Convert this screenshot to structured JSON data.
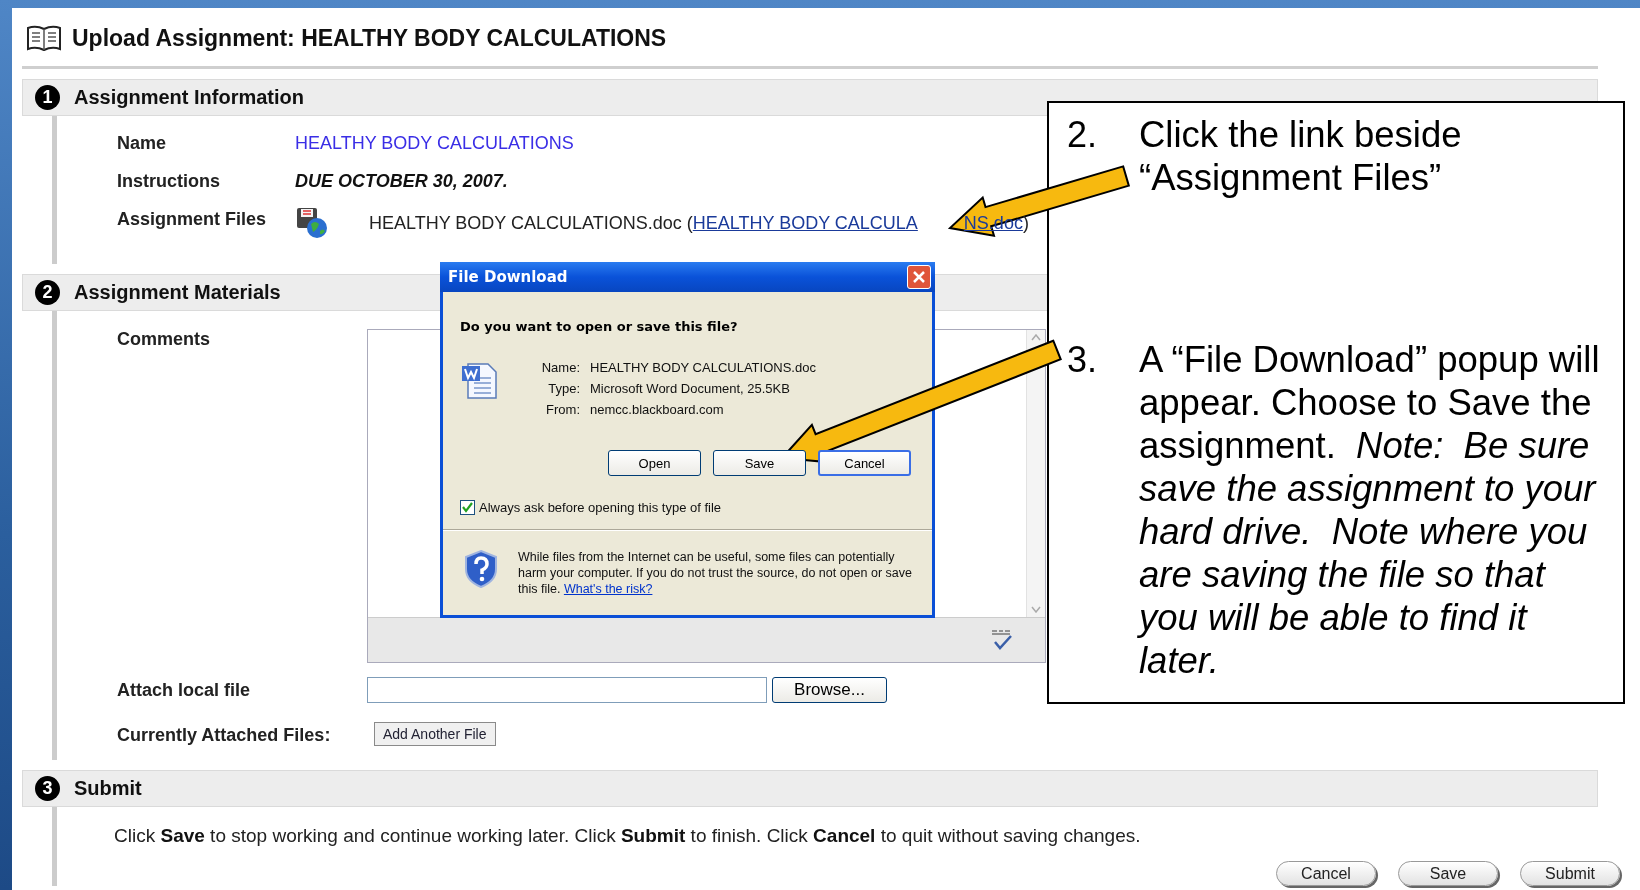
{
  "page": {
    "title": "Upload Assignment: HEALTHY BODY CALCULATIONS"
  },
  "sections": [
    {
      "number": "1",
      "title": "Assignment Information"
    },
    {
      "number": "2",
      "title": "Assignment Materials"
    },
    {
      "number": "3",
      "title": "Submit"
    }
  ],
  "info": {
    "name_label": "Name",
    "name_value": "HEALTHY BODY CALCULATIONS",
    "instructions_label": "Instructions",
    "instructions_value": "DUE OCTOBER 30, 2007.",
    "files_label": "Assignment Files",
    "file_text": "HEALTHY BODY CALCULATIONS.doc (",
    "file_link_parts": [
      "HEALTHY BODY CALCULA",
      "NS.doc"
    ],
    "file_close": ")"
  },
  "materials": {
    "comments_label": "Comments",
    "attach_label": "Attach local file",
    "browse": "Browse...",
    "attached_label": "Currently Attached Files:",
    "add_file": "Add Another File"
  },
  "submit": {
    "text": "Click **Save** to stop working and continue working later. Click **Submit** to finish. Click **Cancel** to quit without saving changes.",
    "buttons": [
      "Cancel",
      "Save",
      "Submit"
    ]
  },
  "dialog": {
    "title": "File Download",
    "question": "Do you want to open or save this file?",
    "fields": [
      {
        "label": "Name:",
        "value": "HEALTHY BODY CALCULATIONS.doc"
      },
      {
        "label": "Type:",
        "value": "Microsoft Word Document, 25.5KB"
      },
      {
        "label": "From:",
        "value": "nemcc.blackboard.com"
      }
    ],
    "buttons": [
      {
        "label": "Open",
        "default": false
      },
      {
        "label": "Save",
        "default": false
      },
      {
        "label": "Cancel",
        "default": true
      }
    ],
    "always_ask": {
      "label": "Always ask before opening this type of file",
      "checked": true
    },
    "warning": "While files from the Internet can be useful, some files can potentially harm your computer. If you do not trust the source, do not open or save this file.",
    "risk_link": "What's the risk?"
  },
  "callout": {
    "steps": [
      {
        "number": "2.",
        "text": "Click the link beside “Assignment Files”"
      },
      {
        "number": "3.",
        "text": "A “File Download” popup will appear. Choose to Save the assignment.  *Note:  Be sure save the assignment to your hard drive.  Note where you are saving the file so that you will be able to find it later.*"
      }
    ]
  }
}
